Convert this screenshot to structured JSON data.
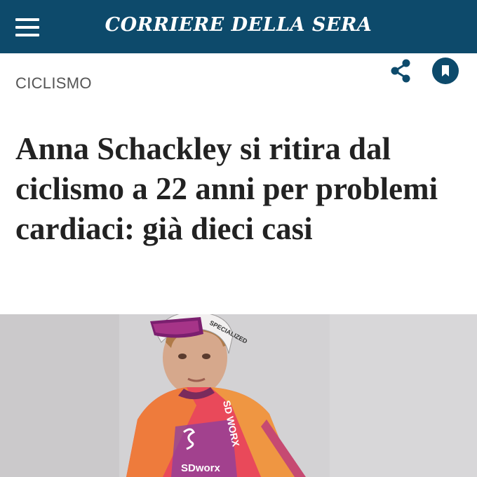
{
  "header": {
    "brand": "CORRIERE DELLA SERA",
    "menu_icon": "hamburger-menu-icon",
    "background": "#0d4a6b"
  },
  "toolbar": {
    "share_icon": "share-icon",
    "bookmark_icon": "bookmark-icon",
    "icon_color": "#0d4a6b"
  },
  "article": {
    "section": "CICLISMO",
    "headline": "Anna Schackley si ritira dal ciclismo a 22 anni per problemi cardiaci: già dieci casi",
    "image": {
      "subject": "cyclist-photo",
      "helmet_text": "SPECIALIZED",
      "jersey_text_1": "SD WORX",
      "jersey_text_2": "SDworx"
    }
  }
}
